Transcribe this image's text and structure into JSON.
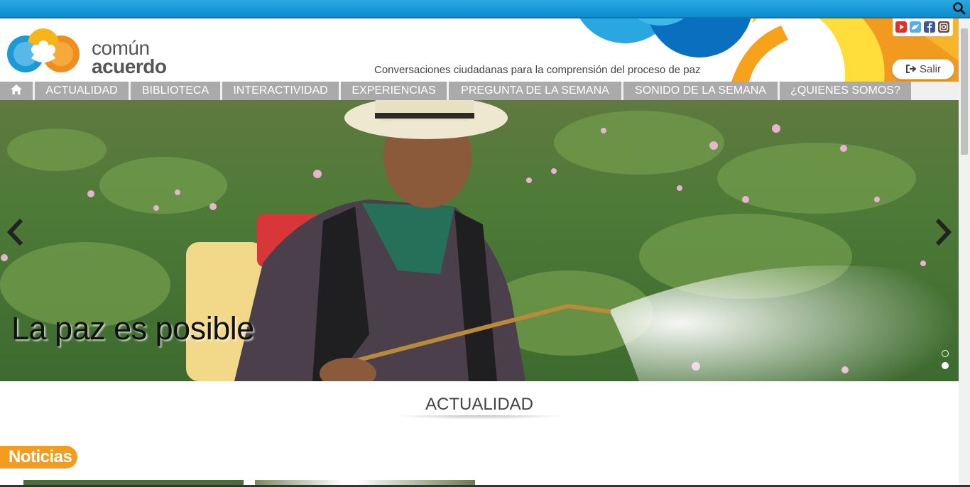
{
  "header": {
    "logo_line1": "común",
    "logo_line2": "acuerdo",
    "tagline": "Conversaciones ciudadanas para la comprensión del proceso de paz",
    "salir_label": "Salir",
    "social_icons": [
      "youtube-icon",
      "twitter-icon",
      "facebook-icon",
      "instagram-icon"
    ]
  },
  "nav": {
    "home_icon": "home-icon",
    "items": [
      {
        "label": "ACTUALIDAD"
      },
      {
        "label": "BIBLIOTECA"
      },
      {
        "label": "INTERACTIVIDAD"
      },
      {
        "label": "EXPERIENCIAS"
      },
      {
        "label": "PREGUNTA DE LA SEMANA"
      },
      {
        "label": "SONIDO DE LA SEMANA"
      },
      {
        "label": "¿QUIENES SOMOS?"
      }
    ]
  },
  "hero": {
    "caption": "La paz es posible",
    "active_slide_index": 1,
    "slide_count": 2
  },
  "main": {
    "section_title": "ACTUALIDAD",
    "noticias_label": "Noticias"
  },
  "colors": {
    "topbar": "#0a8ccf",
    "nav_bg": "#aaaaaa",
    "noticias_badge": "#f39c1e",
    "logo_blue": "#1b9ad6",
    "logo_orange": "#f18d1e"
  }
}
